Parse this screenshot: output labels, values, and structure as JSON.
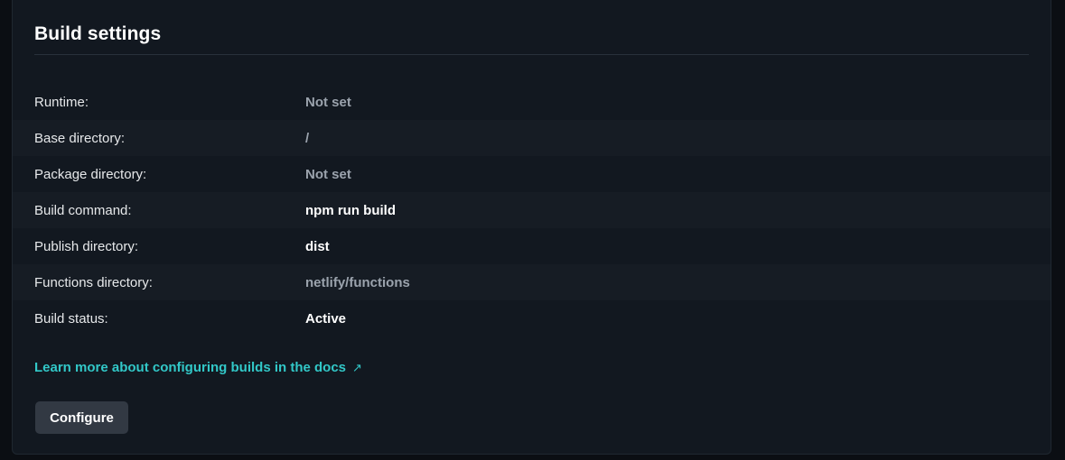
{
  "panel": {
    "title": "Build settings",
    "rows": [
      {
        "label": "Runtime:",
        "value": "Not set",
        "style": "muted"
      },
      {
        "label": "Base directory:",
        "value": "/",
        "style": "muted"
      },
      {
        "label": "Package directory:",
        "value": "Not set",
        "style": "muted"
      },
      {
        "label": "Build command:",
        "value": "npm run build",
        "style": "strong"
      },
      {
        "label": "Publish directory:",
        "value": "dist",
        "style": "strong"
      },
      {
        "label": "Functions directory:",
        "value": "netlify/functions",
        "style": "muted"
      },
      {
        "label": "Build status:",
        "value": "Active",
        "style": "strong"
      }
    ],
    "docs_link": {
      "label": "Learn more about configuring builds in the docs",
      "icon": "external-link-icon"
    },
    "configure_button": {
      "label": "Configure"
    }
  },
  "colors": {
    "background": "#0b0e13",
    "card": "#121820",
    "alt_row": "#161c24",
    "link": "#32c8c8",
    "button": "#323943",
    "muted_text": "#9ba3ad"
  }
}
